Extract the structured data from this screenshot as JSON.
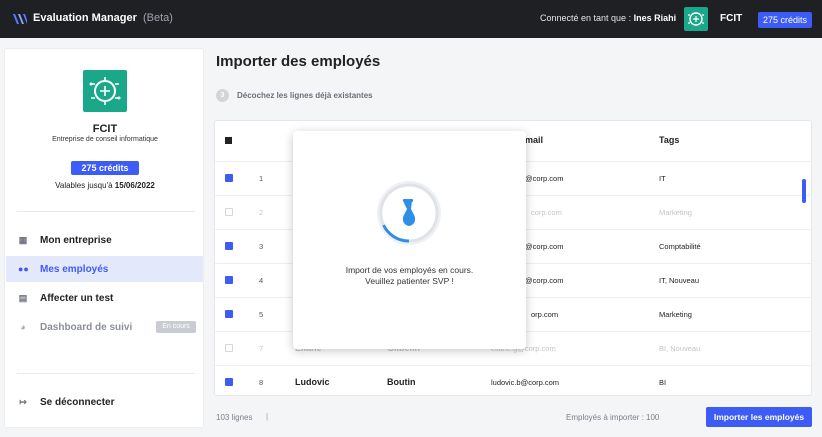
{
  "topbar": {
    "app_name": "Evaluation Manager",
    "app_suffix": "(Beta)",
    "connected_prefix": "Connecté en tant que :",
    "user_name": "Ines Riahi",
    "company": "FCIT",
    "credits": "275 crédits"
  },
  "sidebar": {
    "company_name": "FCIT",
    "company_desc": "Entreprise de conseil informatique",
    "credits": "275 crédits",
    "valid_prefix": "Valables jusqu'à",
    "valid_date": "15/06/2022",
    "nav": [
      {
        "label": "Mon entreprise",
        "icon": "building-icon"
      },
      {
        "label": "Mes employés",
        "icon": "users-icon"
      },
      {
        "label": "Affecter un test",
        "icon": "clipboard-icon"
      },
      {
        "label": "Dashboard de suivi",
        "icon": "pie-chart-icon",
        "badge": "En cours"
      }
    ],
    "logout": "Se déconnecter"
  },
  "main": {
    "title": "Importer des employés",
    "step_number": "3",
    "step_label": "Décochez les lignes déjà existantes",
    "columns": {
      "email": "mail",
      "tags": "Tags"
    },
    "rows": [
      {
        "num": "1",
        "first": "",
        "last": "",
        "email": "@corp.com",
        "tags": "IT",
        "checked": true
      },
      {
        "num": "2",
        "first": "",
        "last": "",
        "email": "corp.com",
        "tags": "Marketing",
        "checked": false
      },
      {
        "num": "3",
        "first": "",
        "last": "",
        "email": "@corp.com",
        "tags": "Comptabilité",
        "checked": true
      },
      {
        "num": "4",
        "first": "",
        "last": "",
        "email": "@corp.com",
        "tags": "IT, Nouveau",
        "checked": true
      },
      {
        "num": "5",
        "first": "",
        "last": "",
        "email": "orp.com",
        "tags": "Marketing",
        "checked": true
      },
      {
        "num": "7",
        "first": "Eliane",
        "last": "Gilbelin",
        "email": "eliane.g@corp.com",
        "tags": "BI, Nouveau",
        "checked": false
      },
      {
        "num": "8",
        "first": "Ludovic",
        "last": "Boutin",
        "email": "ludovic.b@corp.com",
        "tags": "BI",
        "checked": true
      }
    ],
    "row_count": "103 lignes",
    "separator": "|",
    "to_import": "Employés à importer : 100",
    "import_button": "Importer les employés"
  },
  "modal": {
    "line1": "Import de vos employés en cours.",
    "line2": "Veuillez patienter SVP !"
  },
  "colors": {
    "accent": "#3d5cf5",
    "brand": "#1ba88a",
    "topbar": "#1f2024"
  }
}
